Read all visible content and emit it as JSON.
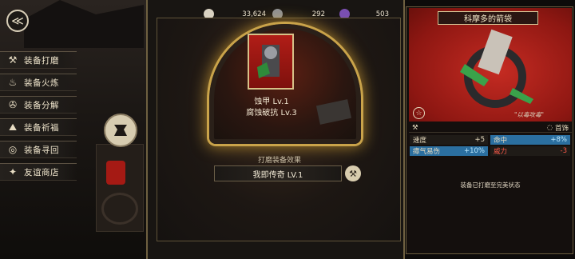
{
  "nav": {
    "back_icon": "chevron-left-icon",
    "anvil_icon": "anvil-icon"
  },
  "menu": {
    "items": [
      {
        "label": "装备打磨",
        "icon": "hammer-icon",
        "glyph": "⚒"
      },
      {
        "label": "装备火炼",
        "icon": "flame-icon",
        "glyph": "♨"
      },
      {
        "label": "装备分解",
        "icon": "disassemble-icon",
        "glyph": "✇"
      },
      {
        "label": "装备祈福",
        "icon": "pray-icon",
        "glyph": "⛰"
      },
      {
        "label": "装备寻回",
        "icon": "retrieve-icon",
        "glyph": "◎"
      },
      {
        "label": "友谊商店",
        "icon": "shop-fox-icon",
        "glyph": "✦"
      }
    ]
  },
  "resources": {
    "bone": "33,624",
    "iron": "292",
    "crystal": "503"
  },
  "item": {
    "name": "蚀甲 Lv.1",
    "trait": "腐蚀破抗 Lv.3"
  },
  "effect": {
    "title": "打磨装备效果",
    "value": "我即传奇 LV.1"
  },
  "detail": {
    "title": "科摩多的箭袋",
    "quote": "\"以毒攻毒\"",
    "type_label": "首饰",
    "stats": [
      {
        "name": "速度",
        "value": "+5",
        "color": "#efe6d2"
      },
      {
        "name": "命中",
        "value": "+8%",
        "color": "#6fd0ff"
      },
      {
        "name": "瘴气易伤",
        "value": "+10%",
        "color": "#6fd0ff"
      },
      {
        "name": "威力",
        "value": "-3",
        "color": "#ff5a4a"
      }
    ],
    "status": "装备已打磨至完美状态"
  },
  "colors": {
    "accent": "#c9a34a",
    "red": "#b11d17",
    "blue": "#2b6fa0"
  }
}
